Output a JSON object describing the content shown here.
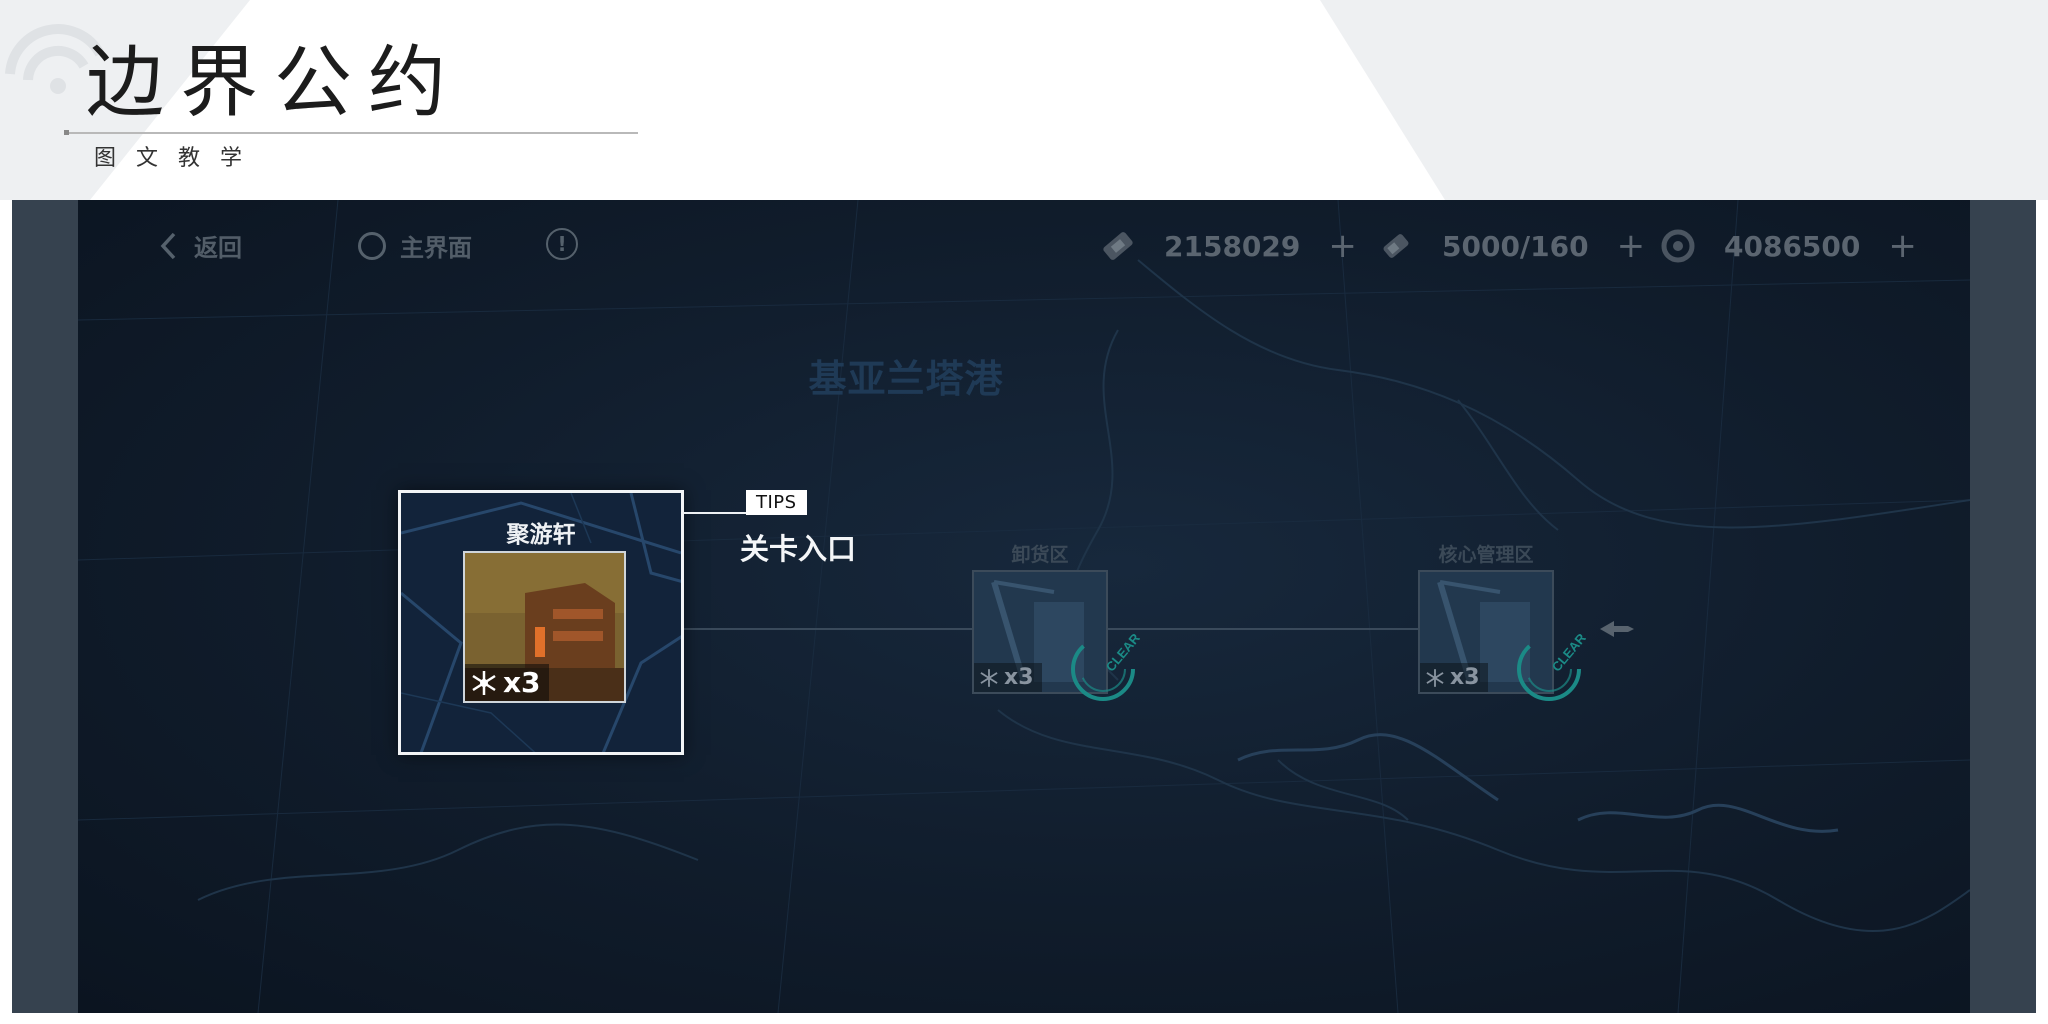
{
  "slide": {
    "title": "边界公约",
    "subtitle": "图文教学"
  },
  "game": {
    "topbar": {
      "back_label": "返回",
      "home_label": "主界面",
      "info_symbol": "!",
      "resources": [
        {
          "icon": "ticket-icon",
          "value": "2158029",
          "plus": "+"
        },
        {
          "icon": "battery-icon",
          "value": "5000/160",
          "plus": "+"
        },
        {
          "icon": "coin-icon",
          "value": "4086500",
          "plus": "+"
        }
      ]
    },
    "area_title": "基亚兰塔港",
    "stages": [
      {
        "title": "聚游轩",
        "multiplier": "x3",
        "highlighted": true
      },
      {
        "title": "卸货区",
        "multiplier": "x3",
        "cleared": true,
        "clear_label": "CLEAR"
      },
      {
        "title": "核心管理区",
        "multiplier": "x3",
        "cleared": true,
        "clear_label": "CLEAR"
      }
    ],
    "tips": {
      "tag": "TIPS",
      "text": "关卡入口"
    },
    "colors": {
      "screen_bg": "#101c2b",
      "highlight_border": "#f2f4f6",
      "clear_ring": "#1b8a86"
    }
  }
}
